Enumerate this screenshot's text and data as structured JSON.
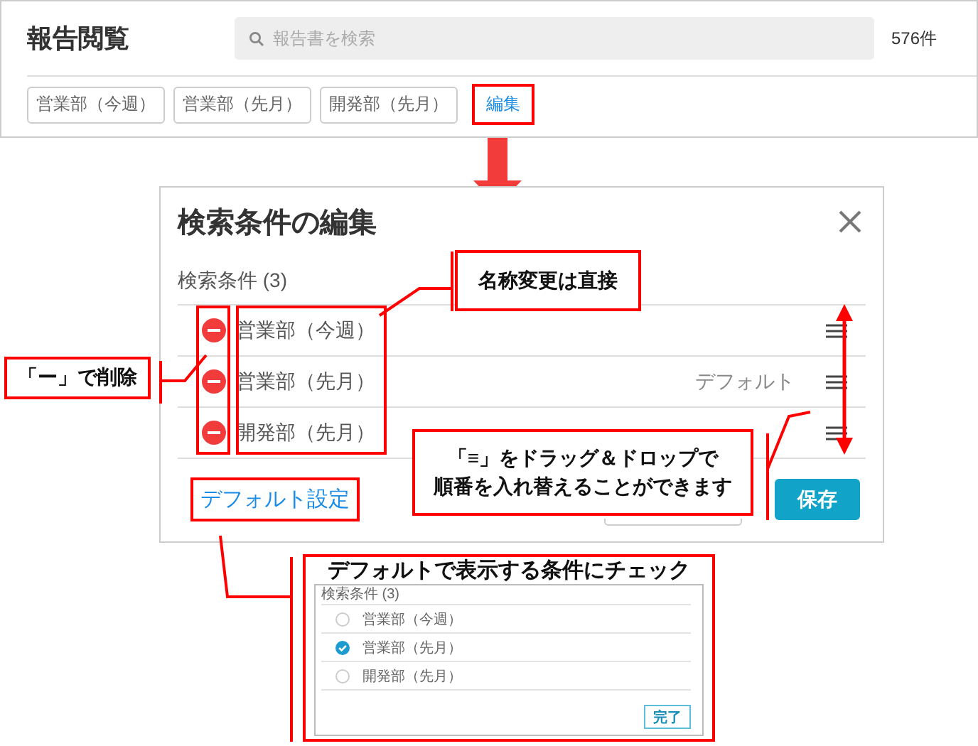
{
  "header": {
    "title": "報告閲覧",
    "search": {
      "placeholder": "報告書を検索"
    },
    "count": "576件"
  },
  "saved_searches": [
    {
      "label": "営業部（今週）"
    },
    {
      "label": "営業部（先月）"
    },
    {
      "label": "開発部（先月）"
    }
  ],
  "edit_link": "編集",
  "dialog": {
    "title": "検索条件の編集",
    "section_label": "検索条件 (3)",
    "conditions": [
      {
        "name": "営業部（今週）"
      },
      {
        "name": "営業部（先月）",
        "badge": "デフォルト"
      },
      {
        "name": "開発部（先月）"
      }
    ],
    "default_setting_link": "デフォルト設定",
    "save_button": "保存"
  },
  "default_inset": {
    "title": "デフォルトで表示する条件にチェック",
    "section_label": "検索条件 (3)",
    "conditions": [
      {
        "name": "営業部（今週）",
        "selected": false
      },
      {
        "name": "営業部（先月）",
        "selected": true
      },
      {
        "name": "開発部（先月）",
        "selected": false
      }
    ],
    "done_button": "完了"
  },
  "annotations": [
    {
      "kind": "rename",
      "text": "名称変更は直接"
    },
    {
      "kind": "delete",
      "text": "「ー」で削除"
    },
    {
      "kind": "reorder",
      "lines": [
        "「≡」をドラッグ＆ドロップで",
        "順番を入れ替えることができます"
      ]
    }
  ]
}
